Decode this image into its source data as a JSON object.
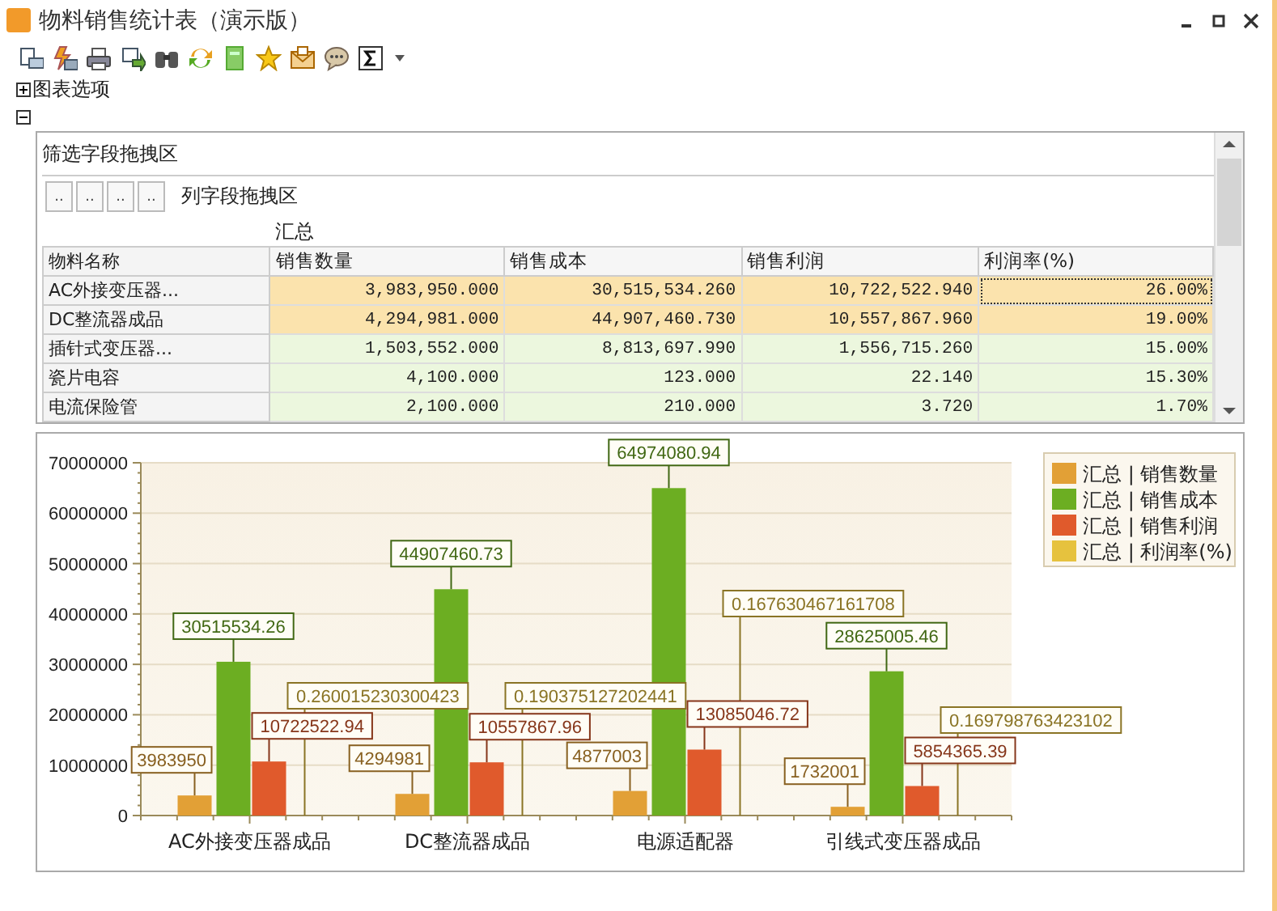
{
  "window": {
    "title": "物料销售统计表（演示版）"
  },
  "chart_options": {
    "label": "图表选项",
    "expanded": false
  },
  "pivot_section": {
    "expanded": true
  },
  "pivot": {
    "filter_area": "筛选字段拖拽区",
    "column_area": "列字段拖拽区",
    "field_buttons": [
      "..",
      "..",
      "..",
      ".."
    ],
    "group_header": "汇总",
    "row_header": "物料名称",
    "columns": [
      "销售数量",
      "销售成本",
      "销售利润",
      "利润率(%)"
    ],
    "rows": [
      {
        "name": "AC外接变压器...",
        "values": [
          "3,983,950.000",
          "30,515,534.260",
          "10,722,522.940",
          "26.00%"
        ],
        "highlighted": true,
        "focused": true
      },
      {
        "name": "DC整流器成品",
        "values": [
          "4,294,981.000",
          "44,907,460.730",
          "10,557,867.960",
          "19.00%"
        ],
        "highlighted": true,
        "focused": false
      },
      {
        "name": "插针式变压器...",
        "values": [
          "1,503,552.000",
          "8,813,697.990",
          "1,556,715.260",
          "15.00%"
        ],
        "highlighted": false,
        "focused": false
      },
      {
        "name": "瓷片电容",
        "values": [
          "4,100.000",
          "123.000",
          "22.140",
          "15.30%"
        ],
        "highlighted": false,
        "focused": false
      },
      {
        "name": "电流保险管",
        "values": [
          "2,100.000",
          "210.000",
          "3.720",
          "1.70%"
        ],
        "highlighted": false,
        "focused": false
      }
    ]
  },
  "chart": {
    "chart_data": {
      "type": "bar",
      "categories": [
        "AC外接变压器成品",
        "DC整流器成品",
        "电源适配器",
        "引线式变压器成品"
      ],
      "series": [
        {
          "name": "汇总 | 销售数量",
          "color": "#e2a036",
          "values": [
            3983950,
            4294981,
            4877003,
            1732001
          ]
        },
        {
          "name": "汇总 | 销售成本",
          "color": "#6cae22",
          "values": [
            30515534.26,
            44907460.73,
            64974080.94,
            28625005.46
          ]
        },
        {
          "name": "汇总 | 销售利润",
          "color": "#e05a2c",
          "values": [
            10722522.94,
            10557867.96,
            13085046.72,
            5854365.39
          ]
        },
        {
          "name": "汇总 | 利润率(%)",
          "color": "#e6c23e",
          "values": [
            0.260015230300423,
            0.190375127202441,
            0.167630467161708,
            0.169798763423102
          ]
        }
      ],
      "grid": true,
      "legend": true,
      "ylim": [
        0,
        70000000
      ],
      "yticks": [
        0,
        10000000,
        20000000,
        30000000,
        40000000,
        50000000,
        60000000,
        70000000
      ],
      "value_labels": [
        [
          "3983950",
          "4294981",
          "4877003",
          "1732001"
        ],
        [
          "30515534.26",
          "44907460.73",
          "64974080.94",
          "28625005.46"
        ],
        [
          "10722522.94",
          "10557867.96",
          "13085046.72",
          "5854365.39"
        ],
        [
          "0.260015230300423",
          "0.190375127202441",
          "0.167630467161708",
          "0.169798763423102"
        ]
      ]
    }
  }
}
